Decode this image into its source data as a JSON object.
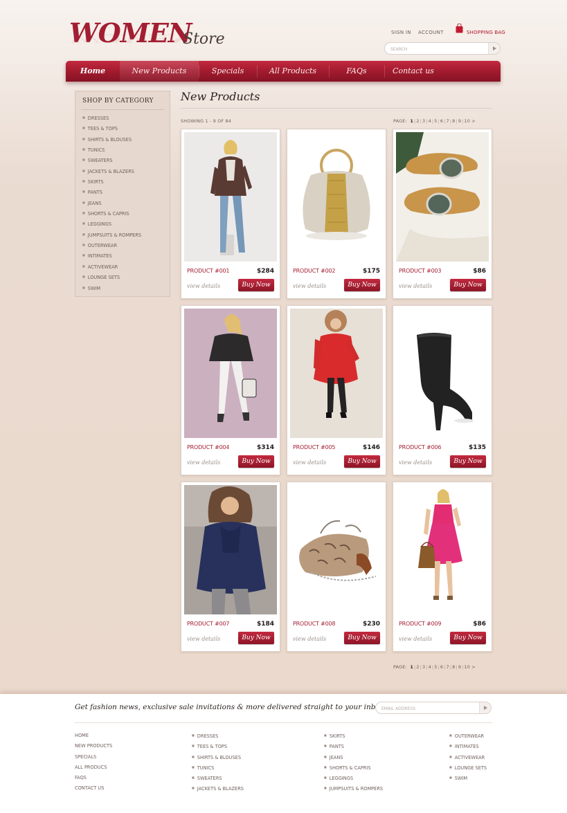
{
  "brand": {
    "logo_main": "WOMEN",
    "logo_sub": "Store"
  },
  "header": {
    "sign_in": "SIGN IN",
    "account": "ACCOUNT",
    "shopping_bag": "SHOPPING BAG",
    "search_placeholder": "SEARCH"
  },
  "nav": [
    {
      "label": "Home"
    },
    {
      "label": "New Products"
    },
    {
      "label": "Specials"
    },
    {
      "label": "All Products"
    },
    {
      "label": "FAQs"
    },
    {
      "label": "Contact us"
    }
  ],
  "sidebar": {
    "title": "SHOP BY CATEGORY",
    "items": [
      "DRESSES",
      "TEES & TOPS",
      "SHIRTS & BLOUSES",
      "TUNICS",
      "SWEATERS",
      "JACKETS & BLAZERS",
      "SKIRTS",
      "PANTS",
      "JEANS",
      "SHORTS & CAPRIS",
      "LEGGINGS",
      "JUMPSUITS & ROMPERS",
      "OUTERWEAR",
      "INTIMATES",
      "ACTIVEWEAR",
      "LOUNGE SETS",
      "SWIM"
    ]
  },
  "content": {
    "title": "New Products",
    "showing": "SHOWING 1 - 9 OF 84",
    "pager_label": "PAGE:",
    "pages": [
      "1",
      "2",
      "3",
      "4",
      "5",
      "6",
      "7",
      "8",
      "9",
      "10 >"
    ],
    "view_details": "view details",
    "buy_now": "Buy Now"
  },
  "products": [
    {
      "name": "PRODUCT #001",
      "price": "$284"
    },
    {
      "name": "PRODUCT #002",
      "price": "$175"
    },
    {
      "name": "PRODUCT #003",
      "price": "$86"
    },
    {
      "name": "PRODUCT #004",
      "price": "$314"
    },
    {
      "name": "PRODUCT #005",
      "price": "$146"
    },
    {
      "name": "PRODUCT #006",
      "price": "$135"
    },
    {
      "name": "PRODUCT #007",
      "price": "$184"
    },
    {
      "name": "PRODUCT #008",
      "price": "$230"
    },
    {
      "name": "PRODUCT #009",
      "price": "$86"
    }
  ],
  "footer": {
    "newsletter": "Get fashion news, exclusive sale invitations & more delivered straight to your inbox!",
    "email_placeholder": "EMAIL ADDRESS",
    "col1": [
      "HOME",
      "NEW PRODUCTS",
      "SPECIALS",
      "ALL PRODUCS",
      "FAQS",
      "CONTACT US"
    ],
    "col2": [
      "DRESSES",
      "TEES & TOPS",
      "SHIRTS & BLOUSES",
      "TUNICS",
      "SWEATERS",
      "JACKETS & BLAZERS"
    ],
    "col3": [
      "SKIRTS",
      "PANTS",
      "JEANS",
      "SHORTS & CAPRIS",
      "LEGGINGS",
      "JUMPSUITS & ROMPERS"
    ],
    "col4": [
      "OUTERWEAR",
      "INTIMATES",
      "ACTIVEWEAR",
      "LOUNGE SETS",
      "SWIM"
    ]
  },
  "colors": {
    "brand_red": "#a31e32",
    "nav_dark": "#861324",
    "background": "#ead9cc"
  }
}
